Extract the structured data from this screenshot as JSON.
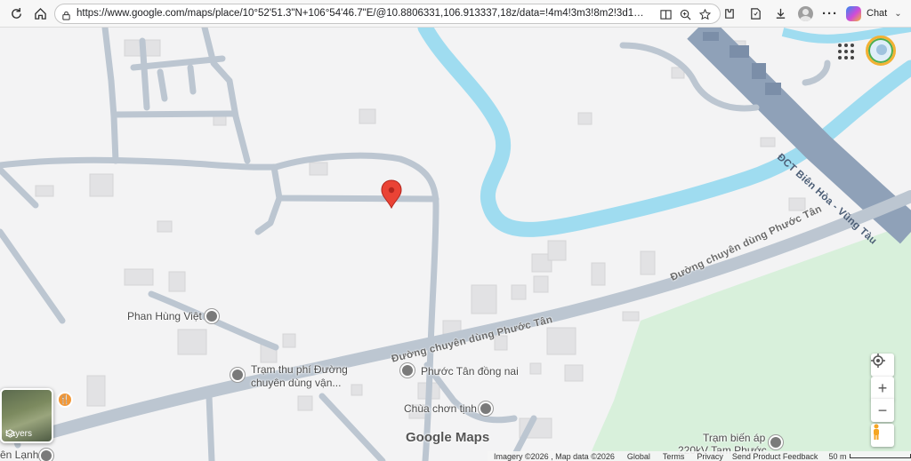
{
  "browser": {
    "url": "https://www.google.com/maps/place/10°52'51.3\"N+106°54'46.7\"E/@10.8806331,106.913337,18z/data=!4m4!3m3!8m2!3d10.880907!4...",
    "chat_label": "Chat",
    "icons": [
      "refresh-icon",
      "home-icon",
      "site-info-icon",
      "split-screen-icon",
      "zoom-icon",
      "favorite-icon",
      "extensions-icon",
      "collections-icon",
      "downloads-icon",
      "profile-icon",
      "more-icon",
      "copilot-icon"
    ]
  },
  "map": {
    "road_labels": {
      "bien_hoa": "ĐCT Biên Hòa - Vũng Tàu",
      "phuoc_tan_upper": "Đường chuyên dùng Phước Tân",
      "phuoc_tan_lower": "Đường chuyên dùng Phước Tân"
    },
    "places": {
      "phan_hung_viet": "Phan Hùng Việt",
      "toll_line1": "Trạm thu phí Đường",
      "toll_line2": "chuyên dùng vận...",
      "phuoc_tan_dong_nai": "Phước Tân đồng nai",
      "chua_chon_tinh": "Chùa chơn tịnh",
      "tram_bien_ap_1": "Trạm biến áp",
      "tram_bien_ap_2": "220kV Tam Phước",
      "edge_label": "ên Lạnh"
    },
    "watermark": "Google Maps",
    "layers_label": "Layers",
    "controls": {
      "zoom_in": "+",
      "zoom_out": "−"
    },
    "colors": {
      "water": "#9fdcf0",
      "road": "#bcc6d1",
      "highway": "#8fa1b8",
      "pin": "#ea4335",
      "green": "#d9f2dc"
    }
  },
  "footer": {
    "imagery": "Imagery ©2026 , Map data ©2026",
    "global": "Global",
    "terms": "Terms",
    "privacy": "Privacy",
    "feedback": "Send Product Feedback",
    "scale": "50 m"
  }
}
